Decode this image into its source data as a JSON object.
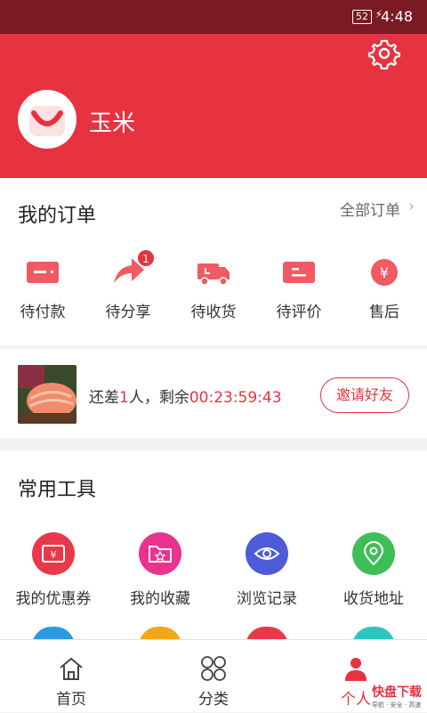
{
  "status_bar": {
    "battery": "52",
    "time": "4:48"
  },
  "profile": {
    "username": "玉米"
  },
  "orders": {
    "title": "我的订单",
    "all_label": "全部订单",
    "items": [
      {
        "label": "待付款",
        "icon": "wallet-icon"
      },
      {
        "label": "待分享",
        "icon": "share-icon",
        "badge": "1"
      },
      {
        "label": "待收货",
        "icon": "truck-icon"
      },
      {
        "label": "待评价",
        "icon": "comment-icon"
      },
      {
        "label": "售后",
        "icon": "yen-icon"
      }
    ]
  },
  "group_buy": {
    "prefix": "还差",
    "count": "1",
    "middle": "人，剩余",
    "countdown": "00:23:59:43",
    "invite_label": "邀请好友"
  },
  "tools": {
    "title": "常用工具",
    "items": [
      {
        "label": "我的优惠券",
        "icon": "coupon-icon",
        "color": "#e8394a"
      },
      {
        "label": "我的收藏",
        "icon": "favorite-folder-icon",
        "color": "#e9338f"
      },
      {
        "label": "浏览记录",
        "icon": "eye-icon",
        "color": "#4d5bd9"
      },
      {
        "label": "收货地址",
        "icon": "location-pin-icon",
        "color": "#3fbe58"
      }
    ],
    "second_row_colors": [
      "#2a9be0",
      "#f3a51c",
      "#e8394a",
      "#2ec4c4"
    ]
  },
  "tabbar": {
    "items": [
      {
        "label": "首页",
        "icon": "home-icon"
      },
      {
        "label": "分类",
        "icon": "category-grid-icon"
      },
      {
        "label": "个人",
        "icon": "person-icon"
      }
    ]
  },
  "watermark": {
    "brand": "快盘下载",
    "sub": "导航 · 安全 · 高速"
  },
  "colors": {
    "primary": "#e7333f",
    "status_bar": "#7a1a22"
  }
}
